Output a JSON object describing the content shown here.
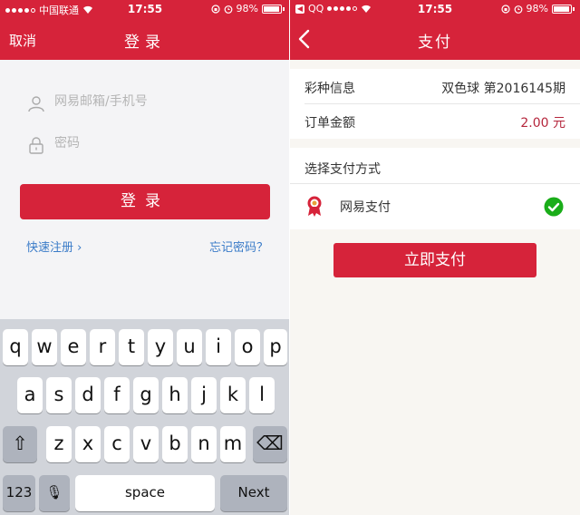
{
  "left": {
    "status": {
      "carrier": "中国联通",
      "time": "17:55",
      "battery": "98%"
    },
    "nav": {
      "cancel": "取消",
      "title": "登录"
    },
    "form": {
      "account_placeholder": "网易邮箱/手机号",
      "password_placeholder": "密码",
      "login_button": "登录",
      "register_link": "快速注册 ›",
      "forgot_link": "忘记密码？"
    },
    "keyboard": {
      "row1": [
        "q",
        "w",
        "e",
        "r",
        "t",
        "y",
        "u",
        "i",
        "o",
        "p"
      ],
      "row2": [
        "a",
        "s",
        "d",
        "f",
        "g",
        "h",
        "j",
        "k",
        "l"
      ],
      "row3": [
        "z",
        "x",
        "c",
        "v",
        "b",
        "n",
        "m"
      ],
      "numbers": "123",
      "space": "space",
      "next": "Next",
      "shift_icon": "⇧",
      "delete_icon": "⌫",
      "mic_icon": "🎙"
    }
  },
  "right": {
    "status": {
      "app": "QQ",
      "time": "17:55",
      "battery": "98%"
    },
    "nav": {
      "title": "支付"
    },
    "order": {
      "lottery_label": "彩种信息",
      "lottery_value": "双色球 第2016145期",
      "amount_label": "订单金额",
      "amount_value": "2.00 元"
    },
    "payment": {
      "section_label": "选择支付方式",
      "method_label": "网易支付",
      "pay_button": "立即支付"
    }
  },
  "colors": {
    "brand_red": "#d6233a",
    "link_blue": "#3a7bc8",
    "check_green": "#1aad19"
  }
}
